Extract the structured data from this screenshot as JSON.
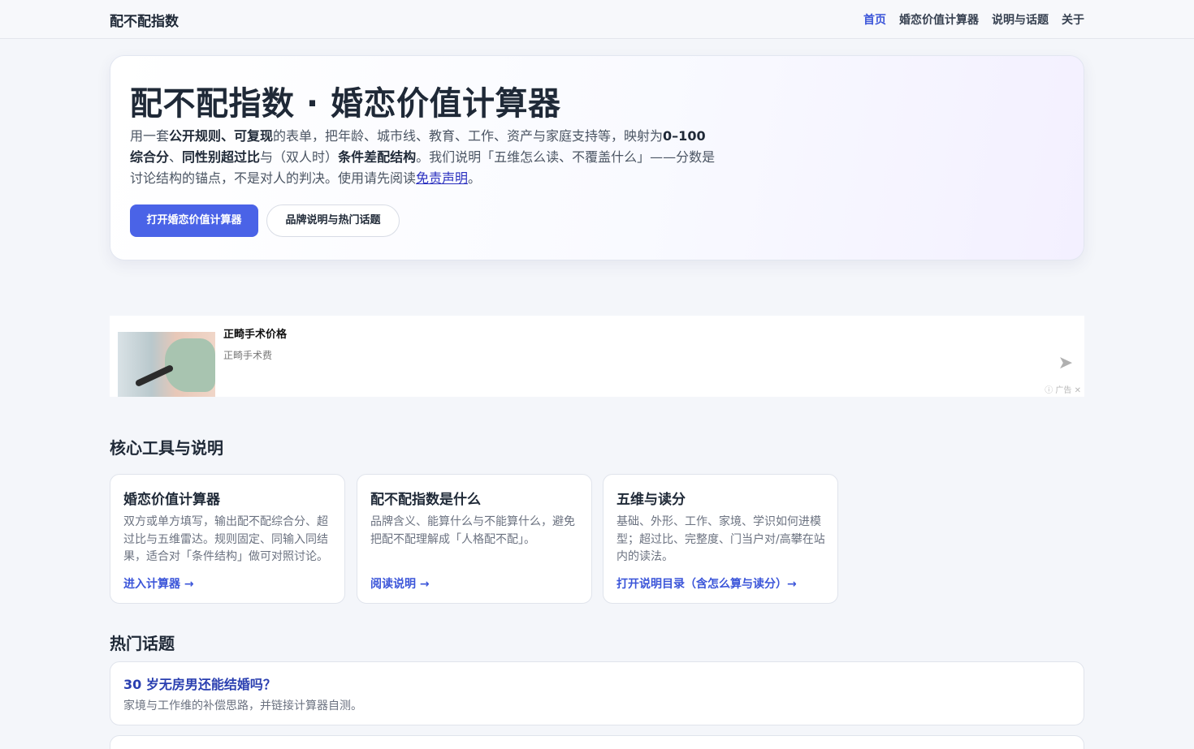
{
  "header": {
    "brand": "配不配指数",
    "nav": [
      "首页",
      "婚恋价值计算器",
      "说明与话题",
      "关于"
    ]
  },
  "hero": {
    "title": "配不配指数 · 婚恋价值计算器",
    "desc": {
      "p1": "用一套",
      "b1": "公开规则、可复现",
      "p2": "的表单，把年龄、城市线、教育、工作、资产与家庭支持等，映射为",
      "b2": "0–100 综合分",
      "p3": "、",
      "b3": "同性别超过比",
      "p4": "与（双人时）",
      "b4": "条件差配结构",
      "p5": "。我们说明「五维怎么读、不覆盖什么」——分数是讨论结构的锚点，不是对人的判决。使用请先阅读",
      "link": "免责声明",
      "p6": "。"
    },
    "primary_button": "打开婚恋价值计算器",
    "secondary_button": "品牌说明与热门话题"
  },
  "ad": {
    "title": "正畸手术价格",
    "subtitle": "正畸手术费",
    "mark": "广告"
  },
  "core_section": {
    "title": "核心工具与说明",
    "cards": [
      {
        "title": "婚恋价值计算器",
        "desc": "双方或单方填写，输出配不配综合分、超过比与五维雷达。规则固定、同输入同结果，适合对「条件结构」做可对照讨论。",
        "link": "进入计算器 →"
      },
      {
        "title": "配不配指数是什么",
        "desc": "品牌含义、能算什么与不能算什么，避免把配不配理解成「人格配不配」。",
        "link": "阅读说明 →"
      },
      {
        "title": "五维与读分",
        "desc": "基础、外形、工作、家境、学识如何进模型；超过比、完整度、门当户对/高攀在站内的读法。",
        "link": "打开说明目录（含怎么算与读分）→"
      }
    ]
  },
  "topics_section": {
    "title": "热门话题",
    "topics": [
      {
        "title": "30 岁无房男还能结婚吗？",
        "desc": "家境与工作维的补偿思路，并链接计算器自测。"
      }
    ]
  }
}
